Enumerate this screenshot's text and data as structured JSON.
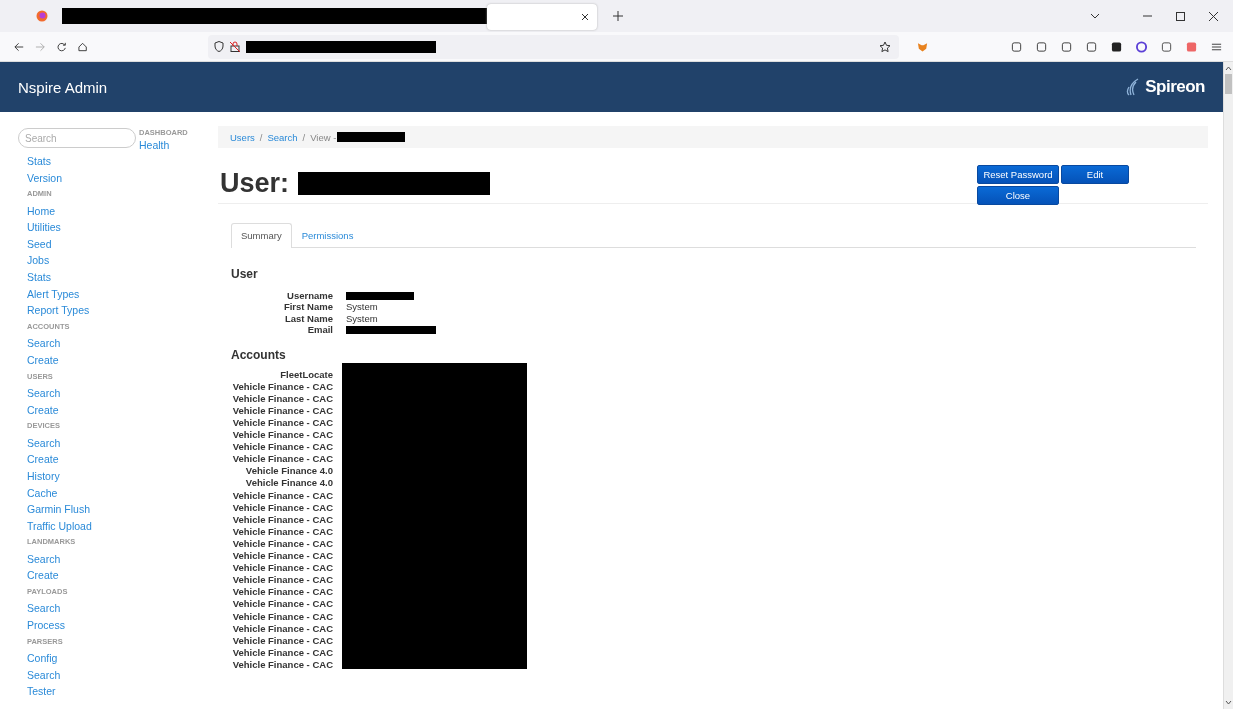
{
  "header": {
    "title": "Nspire Admin",
    "logo": "Spireon"
  },
  "sidebar": {
    "search_placeholder": "Search",
    "sections": [
      {
        "heading": "DASHBOARD",
        "items": [
          "Health",
          "Stats",
          "Version"
        ]
      },
      {
        "heading": "ADMIN",
        "items": [
          "Home",
          "Utilities",
          "Seed",
          "Jobs",
          "Stats",
          "Alert Types",
          "Report Types"
        ]
      },
      {
        "heading": "ACCOUNTS",
        "items": [
          "Search",
          "Create"
        ]
      },
      {
        "heading": "USERS",
        "items": [
          "Search",
          "Create"
        ]
      },
      {
        "heading": "DEVICES",
        "items": [
          "Search",
          "Create",
          "History",
          "Cache",
          "Garmin Flush",
          "Traffic Upload"
        ]
      },
      {
        "heading": "LANDMARKS",
        "items": [
          "Search",
          "Create"
        ]
      },
      {
        "heading": "PAYLOADS",
        "items": [
          "Search",
          "Process"
        ]
      },
      {
        "heading": "PARSERS",
        "items": [
          "Config",
          "Search",
          "Tester"
        ]
      }
    ]
  },
  "breadcrumb": {
    "separator": "/",
    "items": [
      {
        "label": "Users",
        "current": false
      },
      {
        "label": "Search",
        "current": false
      },
      {
        "label": "View -",
        "current": true
      }
    ]
  },
  "page": {
    "title": "User:",
    "buttons": [
      "Reset Password",
      "Edit",
      "Close"
    ],
    "tabs": [
      {
        "label": "Summary",
        "selected": true
      },
      {
        "label": "Permissions",
        "selected": false
      }
    ],
    "user_heading": "User",
    "fields": [
      {
        "label": "Username",
        "redacted": true
      },
      {
        "label": "First Name",
        "value": "System",
        "redacted": false
      },
      {
        "label": "Last Name",
        "value": "System",
        "redacted": false
      },
      {
        "label": "Email",
        "redacted": true
      }
    ],
    "accounts_heading": "Accounts",
    "accounts": [
      "FleetLocate",
      "Vehicle Finance - CAC",
      "Vehicle Finance - CAC",
      "Vehicle Finance - CAC",
      "Vehicle Finance - CAC",
      "Vehicle Finance - CAC",
      "Vehicle Finance - CAC",
      "Vehicle Finance - CAC",
      "Vehicle Finance 4.0",
      "Vehicle Finance 4.0",
      "Vehicle Finance - CAC",
      "Vehicle Finance - CAC",
      "Vehicle Finance - CAC",
      "Vehicle Finance - CAC",
      "Vehicle Finance - CAC",
      "Vehicle Finance - CAC",
      "Vehicle Finance - CAC",
      "Vehicle Finance - CAC",
      "Vehicle Finance - CAC",
      "Vehicle Finance - CAC",
      "Vehicle Finance - CAC",
      "Vehicle Finance - CAC",
      "Vehicle Finance - CAC",
      "Vehicle Finance - CAC",
      "Vehicle Finance - CAC"
    ]
  }
}
